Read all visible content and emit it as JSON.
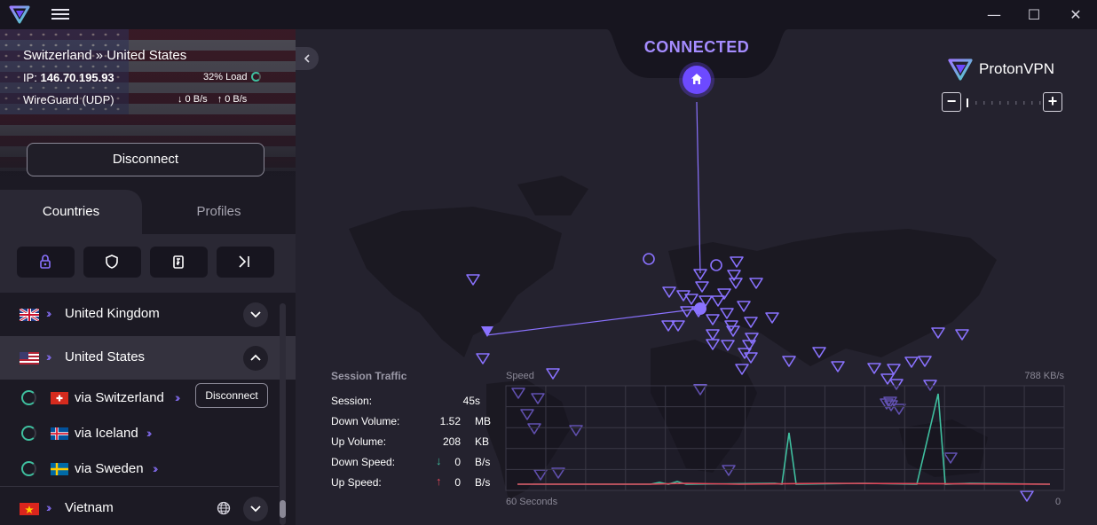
{
  "window": {
    "minimize": "—",
    "maximize": "☐",
    "close": "✕"
  },
  "connection": {
    "route": "Switzerland » United States",
    "ip_label": "IP:",
    "ip": "146.70.195.93",
    "load": "32% Load",
    "protocol": "WireGuard (UDP)",
    "down": "↓ 0 B/s",
    "up": "↑ 0 B/s",
    "disconnect_label": "Disconnect"
  },
  "tabs": {
    "countries": "Countries",
    "profiles": "Profiles"
  },
  "filters": [
    "secure-core-icon",
    "shield-icon",
    "p2p-icon",
    "tor-icon"
  ],
  "countries": [
    {
      "name": "United Kingdom",
      "flag": "uk",
      "expanded": false
    },
    {
      "name": "United States",
      "flag": "us",
      "expanded": true,
      "servers": [
        {
          "name": "via Switzerland",
          "flag": "ch",
          "action": "Disconnect"
        },
        {
          "name": "via Iceland",
          "flag": "is"
        },
        {
          "name": "via Sweden",
          "flag": "se"
        }
      ]
    },
    {
      "name": "Vietnam",
      "flag": "vn",
      "expanded": false
    }
  ],
  "map": {
    "status": "CONNECTED",
    "brand": "ProtonVPN",
    "zoom_out": "−",
    "zoom_in": "+"
  },
  "traffic": {
    "title": "Session Traffic",
    "rows": [
      {
        "label": "Session:",
        "value": "45s",
        "unit": ""
      },
      {
        "label": "Down Volume:",
        "value": "1.52",
        "unit": "MB"
      },
      {
        "label": "Up Volume:",
        "value": "208",
        "unit": "KB"
      },
      {
        "label": "Down Speed:",
        "value": "0",
        "unit": "B/s"
      },
      {
        "label": "Up Speed:",
        "value": "0",
        "unit": "B/s"
      }
    ],
    "speed_label": "Speed",
    "max_label": "788  KB/s",
    "time_label": "60 Seconds",
    "zero_label": "0"
  },
  "colors": {
    "accent": "#6d4aff",
    "accent_light": "#a58cff",
    "download": "#3fbf9f",
    "upload": "#e0475a"
  }
}
